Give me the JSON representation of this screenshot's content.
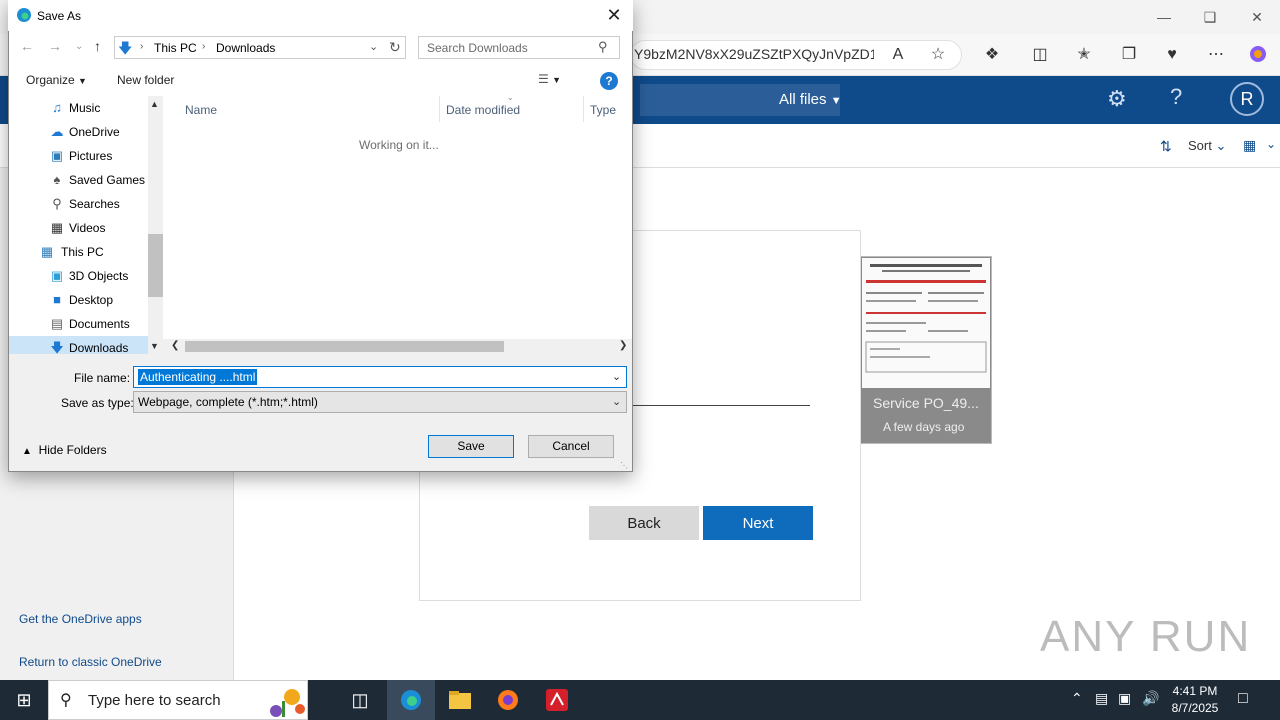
{
  "browser": {
    "address_text": "Y9bzM2NV8xX29uZSZtPXQyJnVpZD1...",
    "read_aloud_label": "A"
  },
  "onedrive": {
    "filter_label": "All files",
    "avatar_initial": "R",
    "sort_label": "Sort",
    "card_name": "Service PO_49...",
    "card_date": "A few days ago",
    "get_apps_link": "Get the OneDrive apps",
    "classic_link": "Return to classic OneDrive",
    "modal_back": "Back",
    "modal_next": "Next"
  },
  "dialog": {
    "title": "Save As",
    "breadcrumb": [
      "This PC",
      "Downloads"
    ],
    "search_placeholder": "Search Downloads",
    "organize_label": "Organize",
    "new_folder_label": "New folder",
    "nav_items": [
      {
        "label": "Music",
        "icon": "music-icon",
        "selected": false
      },
      {
        "label": "OneDrive",
        "icon": "cloud-icon",
        "selected": false
      },
      {
        "label": "Pictures",
        "icon": "pictures-icon",
        "selected": false
      },
      {
        "label": "Saved Games",
        "icon": "games-icon",
        "selected": false
      },
      {
        "label": "Searches",
        "icon": "search-icon",
        "selected": false
      },
      {
        "label": "Videos",
        "icon": "video-icon",
        "selected": false
      },
      {
        "label": "This PC",
        "icon": "computer-icon",
        "selected": false
      },
      {
        "label": "3D Objects",
        "icon": "cube-icon",
        "selected": false
      },
      {
        "label": "Desktop",
        "icon": "desktop-icon",
        "selected": false
      },
      {
        "label": "Documents",
        "icon": "document-icon",
        "selected": false
      },
      {
        "label": "Downloads",
        "icon": "download-icon",
        "selected": true
      }
    ],
    "columns": [
      "Name",
      "Date modified",
      "Type"
    ],
    "status": "Working on it...",
    "file_name_label": "File name:",
    "file_name_value": "Authenticating ....html",
    "save_type_label": "Save as type:",
    "save_type_value": "Webpage, complete (*.htm;*.html)",
    "hide_folders": "Hide Folders",
    "save_label": "Save",
    "cancel_label": "Cancel"
  },
  "taskbar": {
    "search_text": "Type here to search",
    "time": "4:41 PM",
    "date": "8/7/2025"
  },
  "watermark": "ANY RUN"
}
